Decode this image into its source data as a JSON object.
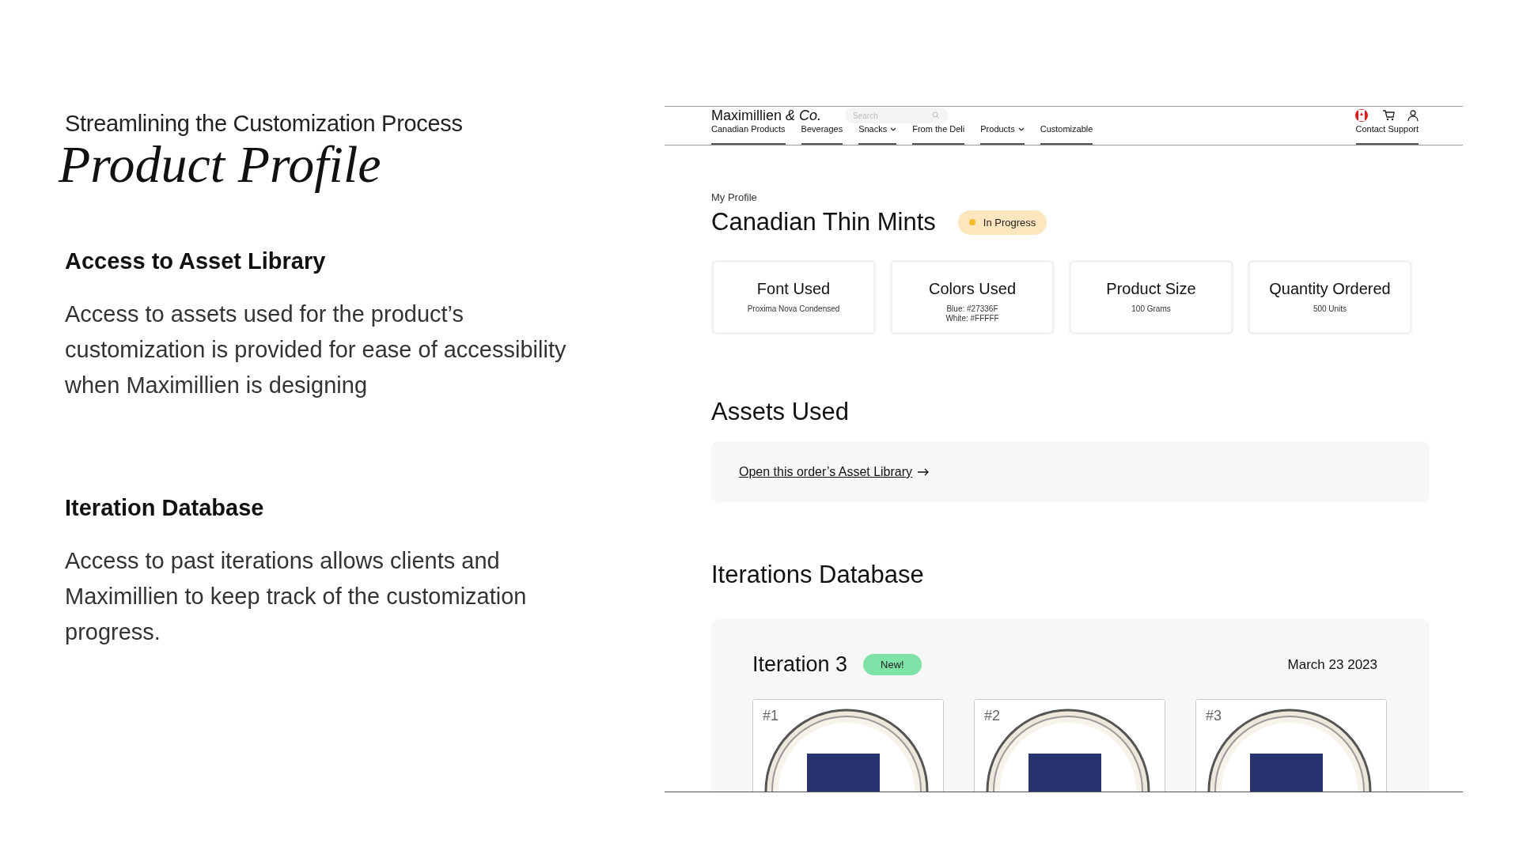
{
  "slide": {
    "subtitle": "Streamlining the Customization Process",
    "title": "Product Profile",
    "sections": [
      {
        "heading": "Access to Asset Library",
        "body": "Access to assets used for the product’s customization is provided for ease of accessibility when Maximillien is designing"
      },
      {
        "heading": "Iteration Database",
        "body": "Access to past iterations allows clients and Maximillien to keep track of the customization progress."
      }
    ]
  },
  "mockup": {
    "logo": "Maximillien *& Co.*",
    "search": {
      "placeholder": "Search"
    },
    "nav": [
      {
        "label": "Canadian Products",
        "has_menu": false
      },
      {
        "label": "Beverages",
        "has_menu": false
      },
      {
        "label": "Snacks",
        "has_menu": true
      },
      {
        "label": "From the Deli",
        "has_menu": false
      },
      {
        "label": "Products",
        "has_menu": true
      },
      {
        "label": "Customizable",
        "has_menu": false
      }
    ],
    "contact": "Contact Support",
    "breadcrumb": "My Profile",
    "product": {
      "name": "Canadian Thin Mints",
      "status": "In Progress"
    },
    "cards": [
      {
        "title": "Font Used",
        "lines": [
          "Proxima Nova Condensed"
        ]
      },
      {
        "title": "Colors Used",
        "lines": [
          "Blue: #27336F",
          "White: #FFFFF"
        ]
      },
      {
        "title": "Product Size",
        "lines": [
          "100 Grams"
        ]
      },
      {
        "title": "Quantity Ordered",
        "lines": [
          "500 Units"
        ]
      }
    ],
    "assets": {
      "heading": "Assets Used",
      "link": "Open this order’s Asset Library"
    },
    "iterations": {
      "heading": "Iterations Database",
      "title": "Iteration 3",
      "badge": "New!",
      "date": "March 23 2023",
      "tiles": [
        {
          "label": "#1"
        },
        {
          "label": "#2"
        },
        {
          "label": "#3"
        }
      ]
    }
  }
}
